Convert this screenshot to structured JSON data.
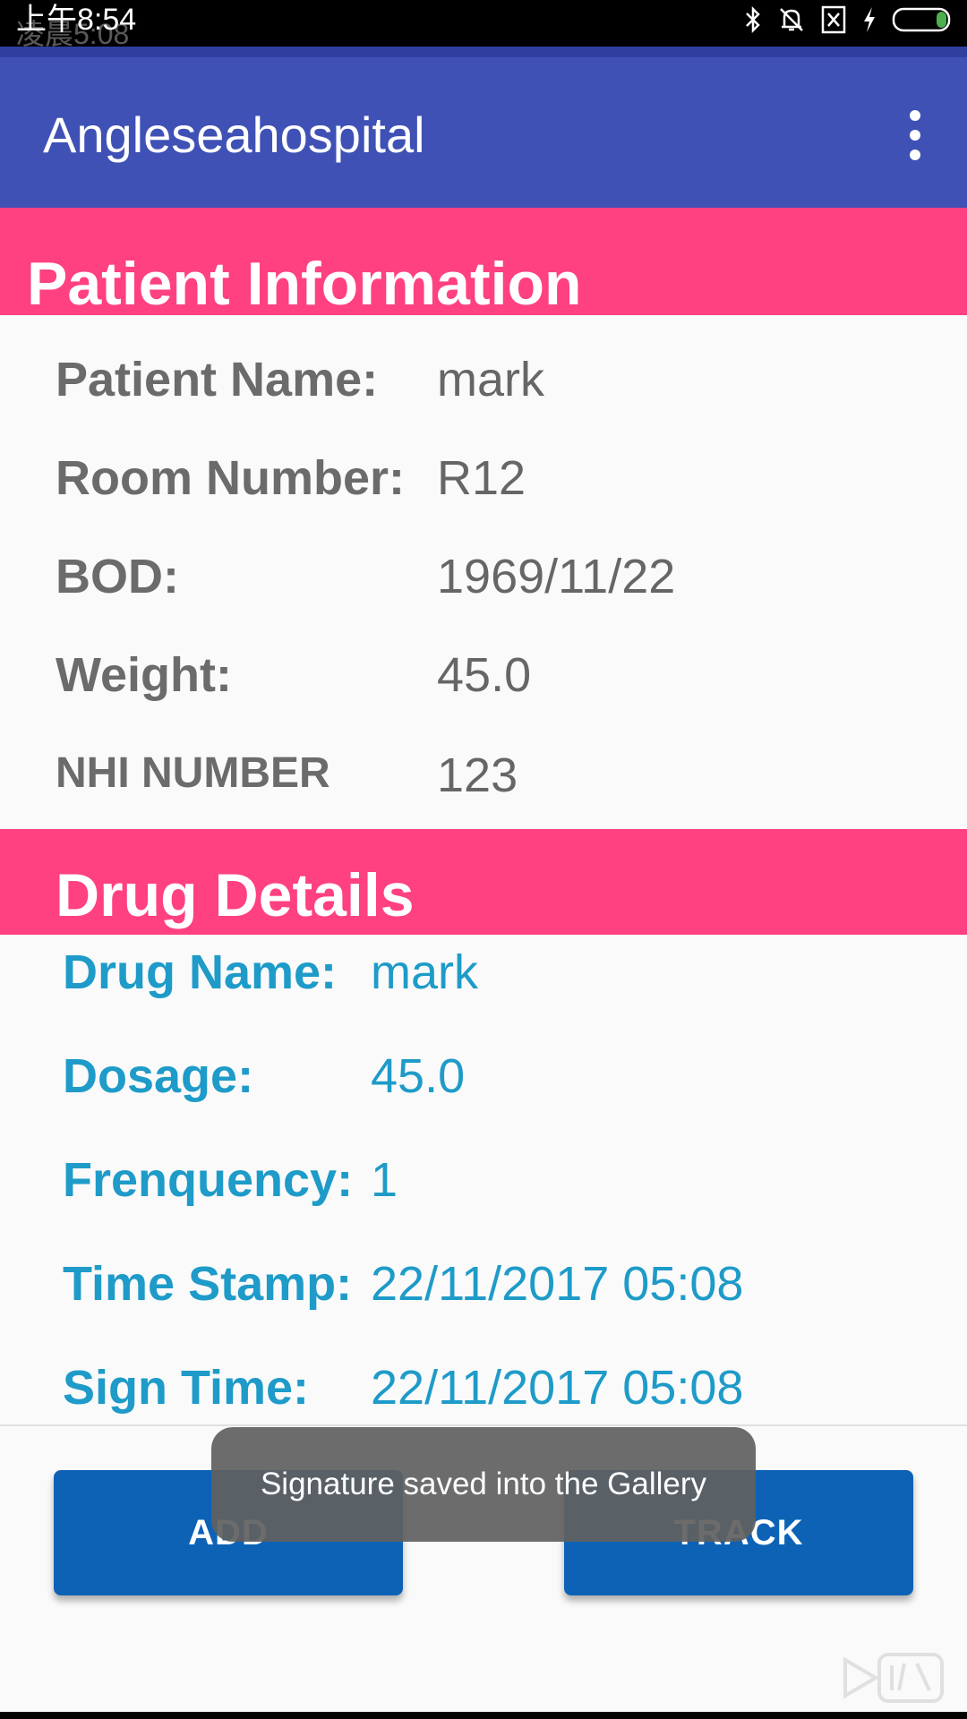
{
  "status_bar": {
    "time": "上午8:54",
    "ghost_time": "凌晨5:08"
  },
  "app_bar": {
    "title": "Angleseahospital"
  },
  "patient_info": {
    "title": "Patient Information",
    "fields": [
      {
        "label": "Patient Name:",
        "value": "mark"
      },
      {
        "label": "Room Number:",
        "value": "R12"
      },
      {
        "label": "BOD:",
        "value": "1969/11/22"
      },
      {
        "label": "Weight:",
        "value": "45.0"
      },
      {
        "label": "NHI NUMBER",
        "value": "123"
      }
    ]
  },
  "drug_details": {
    "title": "Drug Details",
    "fields": [
      {
        "label": "Drug Name:",
        "value": "mark"
      },
      {
        "label": "Dosage:",
        "value": "45.0"
      },
      {
        "label": "Frenquency:",
        "value": "1"
      },
      {
        "label": "Time Stamp:",
        "value": "22/11/2017 05:08"
      },
      {
        "label": "Sign Time:",
        "value": "22/11/2017 05:08"
      }
    ]
  },
  "buttons": {
    "add": "ADD",
    "track": "TRACK"
  },
  "toast": {
    "message": "Signature saved into the Gallery"
  },
  "colors": {
    "app_bar": "#3f51b5",
    "section_header": "#ff4081",
    "drug_text": "#1e9bc8",
    "button": "#0d62b6"
  }
}
